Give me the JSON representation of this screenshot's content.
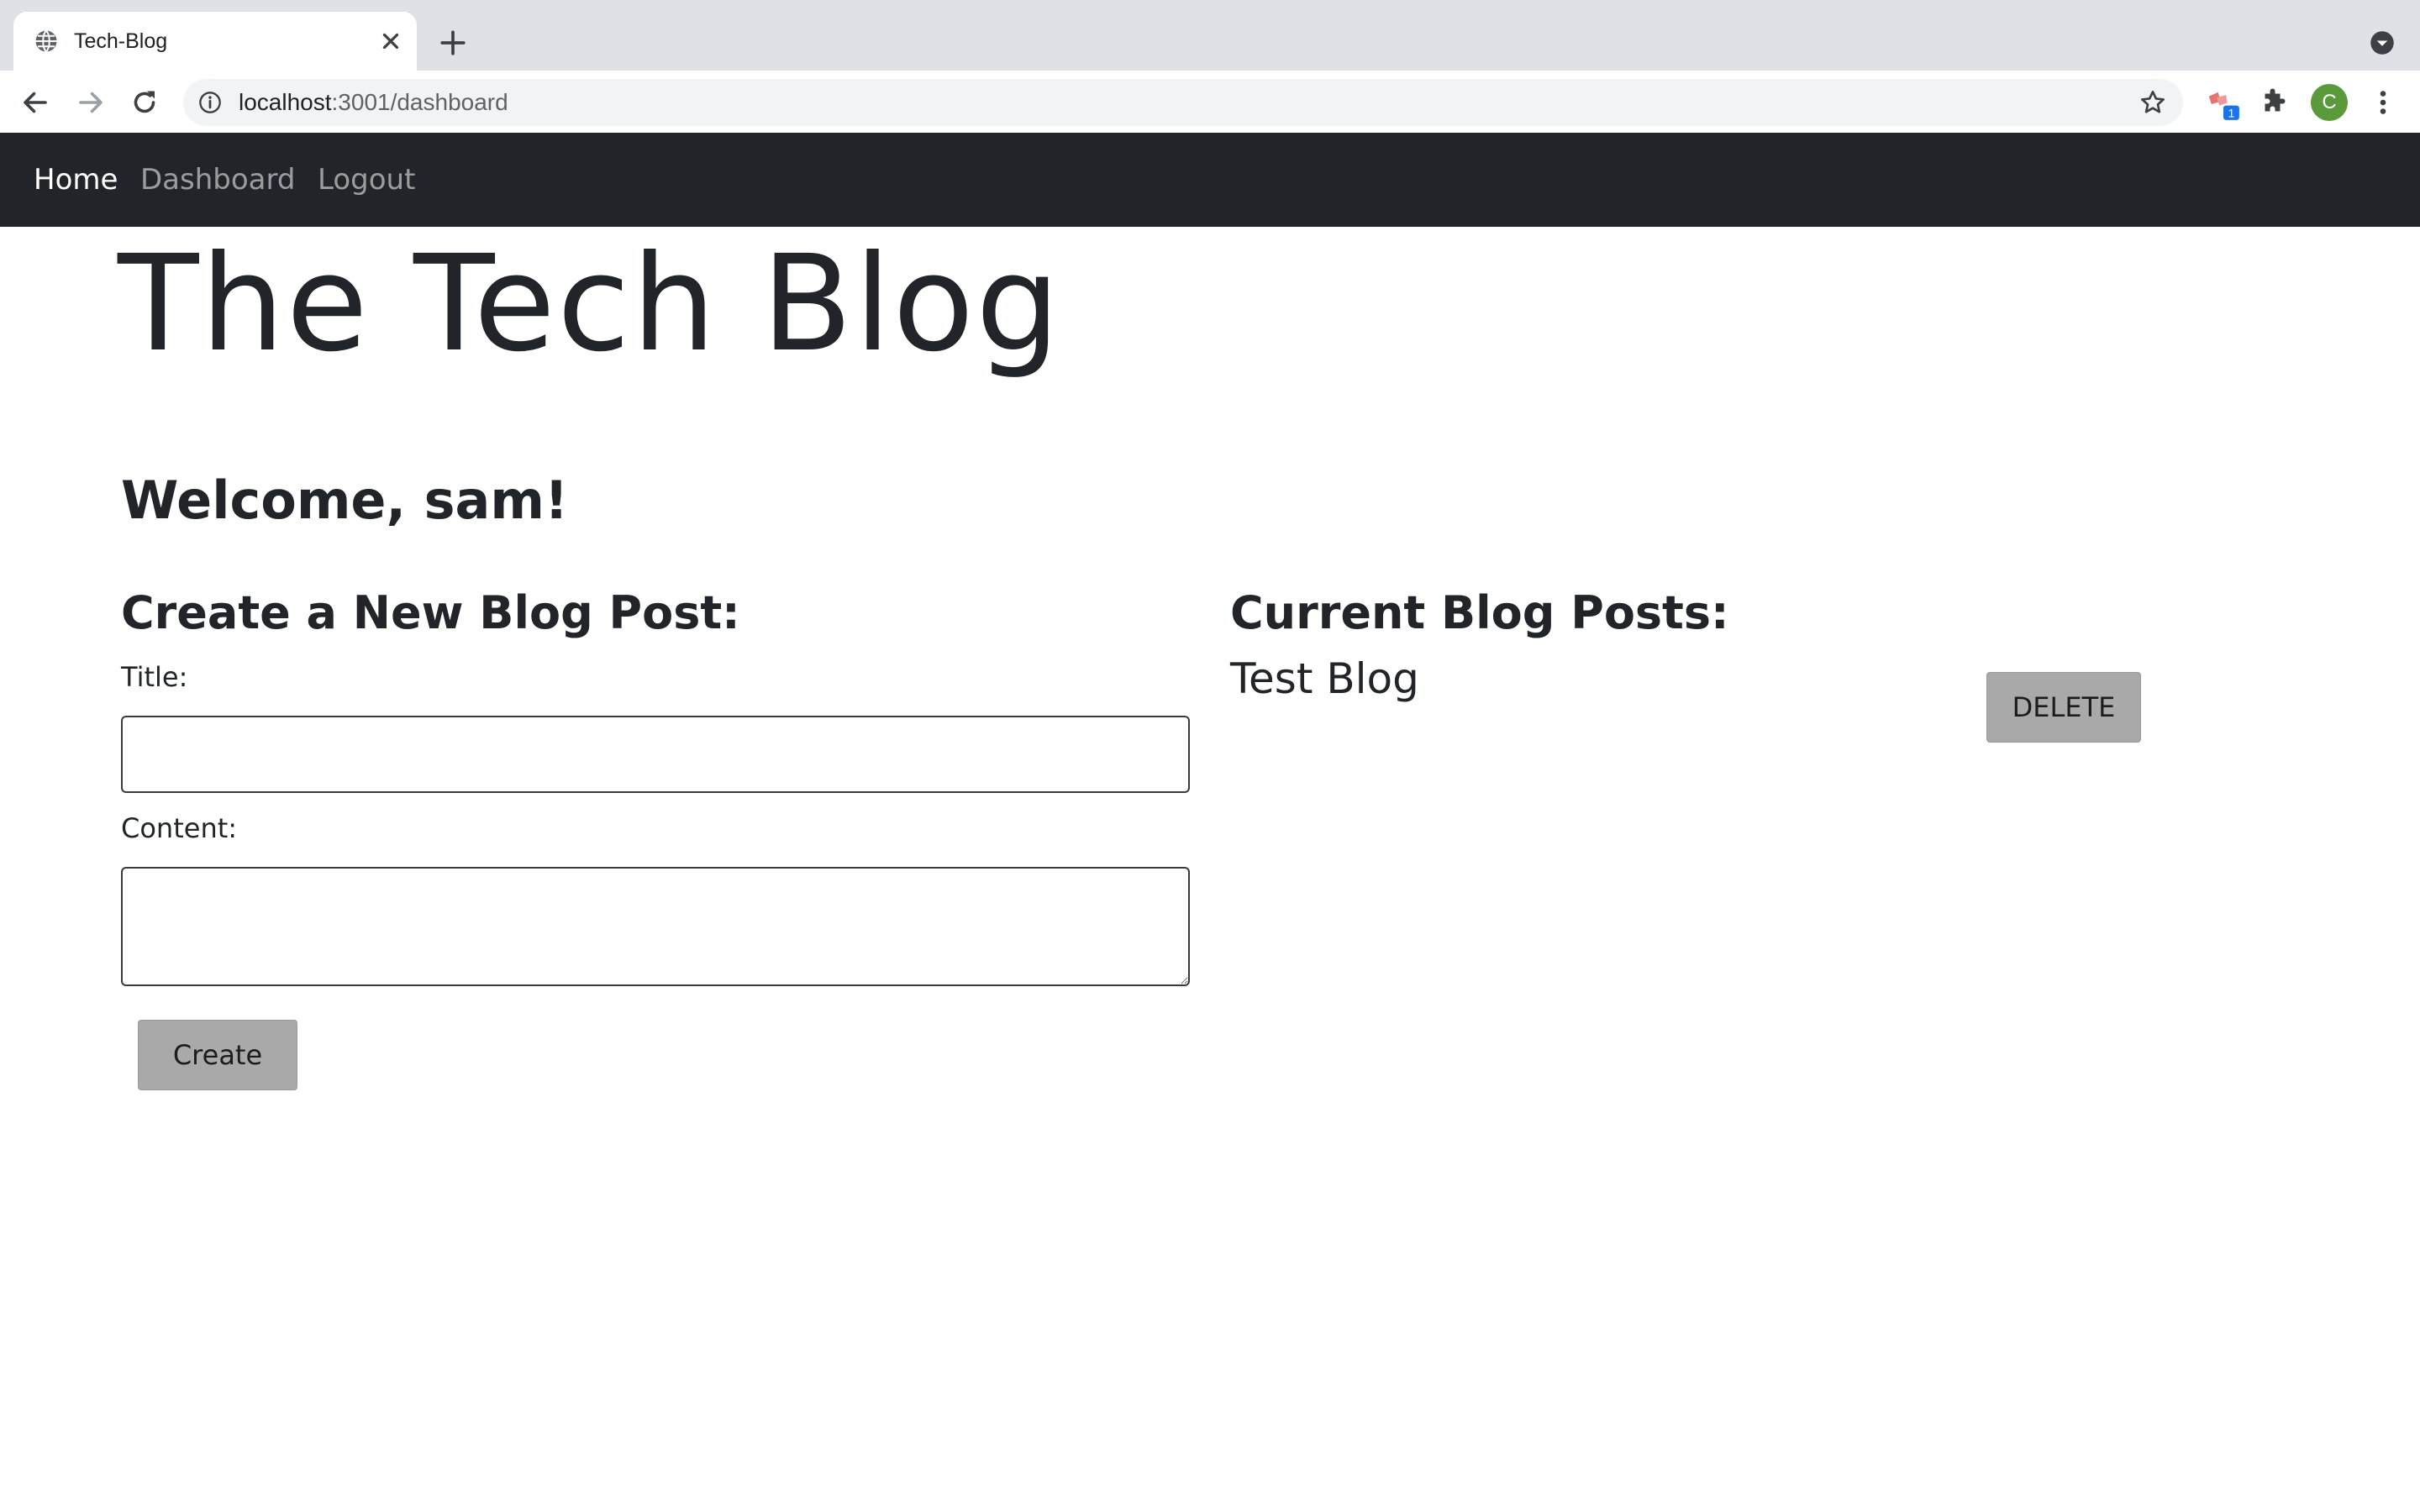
{
  "browser": {
    "tab": {
      "title": "Tech-Blog"
    },
    "address_bar": {
      "host": "localhost",
      "path": ":3001/dashboard"
    },
    "profile_initial": "C",
    "extension_badge": "1"
  },
  "nav": {
    "links": [
      {
        "label": "Home",
        "active": true
      },
      {
        "label": "Dashboard",
        "active": false
      },
      {
        "label": "Logout",
        "active": false
      }
    ]
  },
  "page": {
    "title": "The Tech Blog",
    "welcome": "Welcome, sam!"
  },
  "create_form": {
    "heading": "Create a New Blog Post:",
    "title_label": "Title:",
    "title_value": "",
    "content_label": "Content:",
    "content_value": "",
    "submit_label": "Create"
  },
  "posts": {
    "heading": "Current Blog Posts:",
    "items": [
      {
        "title": "Test Blog",
        "delete_label": "DELETE"
      }
    ]
  },
  "colors": {
    "navbar_bg": "#212529",
    "button_bg": "#a9a9a9",
    "text": "#212529"
  }
}
